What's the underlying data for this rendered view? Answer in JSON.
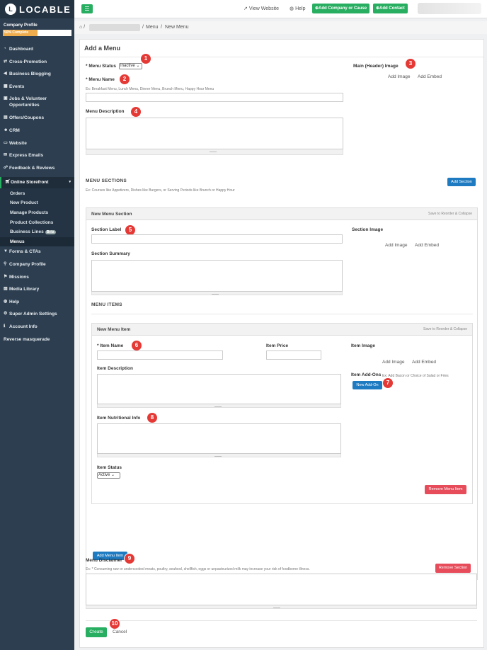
{
  "app": {
    "logo_text": "LOCABLE",
    "logo_letter": "L"
  },
  "sidebar": {
    "profile_label": "Company Profile",
    "profile_progress": 0.5,
    "profile_progress_text": "50% Complete",
    "items": [
      {
        "icon": "dashboard-icon",
        "label": "Dashboard"
      },
      {
        "icon": "cross-promotion-icon",
        "label": "Cross-Promotion"
      },
      {
        "icon": "megaphone-icon",
        "label": "Business Blogging"
      },
      {
        "icon": "calendar-icon",
        "label": "Events"
      },
      {
        "icon": "briefcase-icon",
        "label": "Jobs & Volunteer Opportunities"
      },
      {
        "icon": "ticket-icon",
        "label": "Offers/Coupons"
      },
      {
        "icon": "users-icon",
        "label": "CRM"
      },
      {
        "icon": "monitor-icon",
        "label": "Website"
      },
      {
        "icon": "envelope-icon",
        "label": "Express Emails"
      },
      {
        "icon": "comments-icon",
        "label": "Feedback & Reviews"
      }
    ],
    "storefront": {
      "label": "Online Storefront",
      "sub_items": [
        "Orders",
        "New Product",
        "Manage Products",
        "Product Collections",
        "Business Lines",
        "Menus"
      ],
      "beta_label": "Beta"
    },
    "items2": [
      {
        "icon": "filter-icon",
        "label": "Forms & CTAs"
      },
      {
        "icon": "map-marker-icon",
        "label": "Company Profile"
      },
      {
        "icon": "flag-icon",
        "label": "Missions"
      },
      {
        "icon": "image-icon",
        "label": "Media Library"
      },
      {
        "icon": "globe-icon",
        "label": "Help"
      },
      {
        "icon": "cogs-icon",
        "label": "Super Admin Settings"
      },
      {
        "icon": "info-icon",
        "label": "Account Info"
      },
      {
        "icon": "",
        "label": "Reverse masquerade"
      }
    ]
  },
  "topbar": {
    "view_website": "View Website",
    "help": "Help",
    "add_company": "Add Company or Cause",
    "add_contact": "Add Contact"
  },
  "breadcrumb": {
    "menu": "Menu",
    "new_menu": "New Menu"
  },
  "form": {
    "title": "Add a Menu",
    "menu_status_label": "* Menu Status",
    "menu_status_value": "Inactive",
    "main_image_label": "Main (Header) Image",
    "add_image": "Add Image",
    "add_embed": "Add Embed",
    "menu_name_label": "* Menu Name",
    "menu_name_hint": "Ex: Breakfast Menu, Lunch Menu, Dinner Menu, Brunch Menu, Happy Hour Menu",
    "menu_description_label": "Menu Description",
    "menu_sections_heading": "MENU SECTIONS",
    "menu_sections_hint": "Ex: Courses like Appetizers, Dishes like Burgers, or Serving Periods like Brunch or Happy Hour",
    "add_section": "Add Section",
    "section": {
      "title": "New Menu Section",
      "reorder": "Save to Reorder & Collapse",
      "label": "Section Label",
      "image_label": "Section Image",
      "summary_label": "Section Summary",
      "menu_items_heading": "MENU ITEMS",
      "item": {
        "title": "New Menu Item",
        "reorder": "Save to Reorder & Collapse",
        "name_label": "* Item Name",
        "price_label": "Item Price",
        "image_label": "Item Image",
        "description_label": "Item Description",
        "addons_label": "Item Add-Ons",
        "addons_hint": "Ex: Add Bacon or Choice of Salad or Fries",
        "new_addon": "New Add-On",
        "nutrition_label": "Item Nutritional Info",
        "status_label": "Item Status",
        "status_value": "Active",
        "remove_item": "Remove Menu Item"
      },
      "add_menu_item": "Add Menu Item",
      "remove_section": "Remove Section"
    },
    "disclaimer_label": "Menu Disclaimer",
    "disclaimer_hint": "Ex: * Consuming raw or undercooked meats, poultry, seafood, shellfish, eggs or unpasteurized milk may increase your risk of foodborne illness.",
    "create": "Create",
    "cancel": "Cancel"
  },
  "callouts": [
    "1",
    "2",
    "3",
    "4",
    "5",
    "6",
    "7",
    "8",
    "9",
    "10"
  ],
  "colors": {
    "sidebar_bg": "#2c3e50",
    "accent_green": "#27ae60",
    "accent_blue": "#1f7bc1",
    "danger_red": "#e74c5b",
    "callout_red": "#e53935",
    "progress_orange": "#f0ad4e"
  }
}
